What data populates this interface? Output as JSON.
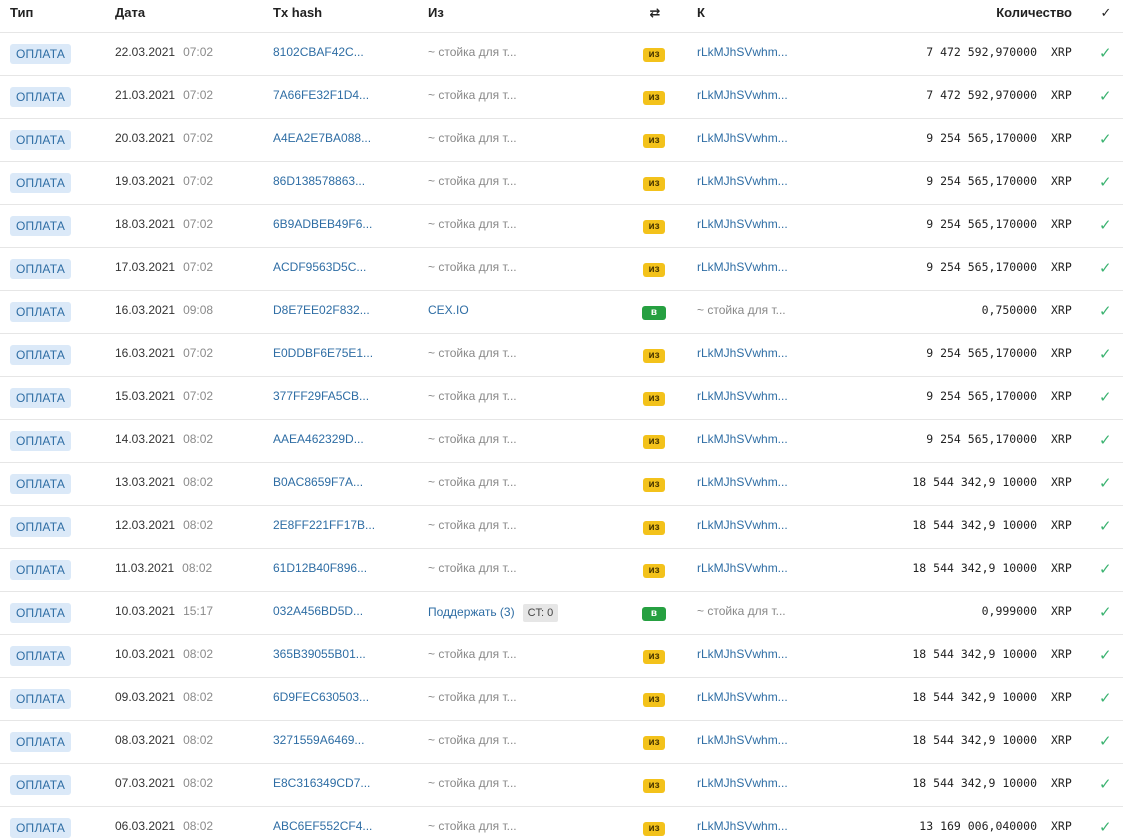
{
  "header": {
    "type": "Тип",
    "date": "Дата",
    "hash": "Tx hash",
    "from": "Из",
    "direction_icon": "⇄",
    "to": "К",
    "amount": "Количество",
    "status_icon": "✓"
  },
  "rows": [
    {
      "type": "ОПЛАТА",
      "date": "22.03.2021",
      "time": "07:02",
      "hash": "8102CBAF42C...",
      "from": "~ стойка для т...",
      "dir": "из",
      "to": "rLkMJhSVwhm...",
      "amount": "7 472 592,970000",
      "currency": "XRP"
    },
    {
      "type": "ОПЛАТА",
      "date": "21.03.2021",
      "time": "07:02",
      "hash": "7A66FE32F1D4...",
      "from": "~ стойка для т...",
      "dir": "из",
      "to": "rLkMJhSVwhm...",
      "amount": "7 472 592,970000",
      "currency": "XRP"
    },
    {
      "type": "ОПЛАТА",
      "date": "20.03.2021",
      "time": "07:02",
      "hash": "A4EA2E7BA088...",
      "from": "~ стойка для т...",
      "dir": "из",
      "to": "rLkMJhSVwhm...",
      "amount": "9 254 565,170000",
      "currency": "XRP"
    },
    {
      "type": "ОПЛАТА",
      "date": "19.03.2021",
      "time": "07:02",
      "hash": "86D138578863...",
      "from": "~ стойка для т...",
      "dir": "из",
      "to": "rLkMJhSVwhm...",
      "amount": "9 254 565,170000",
      "currency": "XRP"
    },
    {
      "type": "ОПЛАТА",
      "date": "18.03.2021",
      "time": "07:02",
      "hash": "6B9ADBEB49F6...",
      "from": "~ стойка для т...",
      "dir": "из",
      "to": "rLkMJhSVwhm...",
      "amount": "9 254 565,170000",
      "currency": "XRP"
    },
    {
      "type": "ОПЛАТА",
      "date": "17.03.2021",
      "time": "07:02",
      "hash": "ACDF9563D5C...",
      "from": "~ стойка для т...",
      "dir": "из",
      "to": "rLkMJhSVwhm...",
      "amount": "9 254 565,170000",
      "currency": "XRP"
    },
    {
      "type": "ОПЛАТА",
      "date": "16.03.2021",
      "time": "09:08",
      "hash": "D8E7EE02F832...",
      "from": "CEX.IO",
      "dir": "в",
      "to": "~ стойка для т...",
      "amount": "0,750000",
      "currency": "XRP"
    },
    {
      "type": "ОПЛАТА",
      "date": "16.03.2021",
      "time": "07:02",
      "hash": "E0DDBF6E75E1...",
      "from": "~ стойка для т...",
      "dir": "из",
      "to": "rLkMJhSVwhm...",
      "amount": "9 254 565,170000",
      "currency": "XRP"
    },
    {
      "type": "ОПЛАТА",
      "date": "15.03.2021",
      "time": "07:02",
      "hash": "377FF29FA5CB...",
      "from": "~ стойка для т...",
      "dir": "из",
      "to": "rLkMJhSVwhm...",
      "amount": "9 254 565,170000",
      "currency": "XRP"
    },
    {
      "type": "ОПЛАТА",
      "date": "14.03.2021",
      "time": "08:02",
      "hash": "AAEA462329D...",
      "from": "~ стойка для т...",
      "dir": "из",
      "to": "rLkMJhSVwhm...",
      "amount": "9 254 565,170000",
      "currency": "XRP"
    },
    {
      "type": "ОПЛАТА",
      "date": "13.03.2021",
      "time": "08:02",
      "hash": "B0AC8659F7A...",
      "from": "~ стойка для т...",
      "dir": "из",
      "to": "rLkMJhSVwhm...",
      "amount": "18 544 342,9 10000",
      "currency": "XRP"
    },
    {
      "type": "ОПЛАТА",
      "date": "12.03.2021",
      "time": "08:02",
      "hash": "2E8FF221FF17B...",
      "from": "~ стойка для т...",
      "dir": "из",
      "to": "rLkMJhSVwhm...",
      "amount": "18 544 342,9 10000",
      "currency": "XRP"
    },
    {
      "type": "ОПЛАТА",
      "date": "11.03.2021",
      "time": "08:02",
      "hash": "61D12B40F896...",
      "from": "~ стойка для т...",
      "dir": "из",
      "to": "rLkMJhSVwhm...",
      "amount": "18 544 342,9 10000",
      "currency": "XRP"
    },
    {
      "type": "ОПЛАТА",
      "date": "10.03.2021",
      "time": "15:17",
      "hash": "032A456BD5D...",
      "from": "Поддержать (3)",
      "from_tag": "CT: 0",
      "dir": "в",
      "to": "~ стойка для т...",
      "amount": "0,999000",
      "currency": "XRP"
    },
    {
      "type": "ОПЛАТА",
      "date": "10.03.2021",
      "time": "08:02",
      "hash": "365B39055B01...",
      "from": "~ стойка для т...",
      "dir": "из",
      "to": "rLkMJhSVwhm...",
      "amount": "18 544 342,9 10000",
      "currency": "XRP"
    },
    {
      "type": "ОПЛАТА",
      "date": "09.03.2021",
      "time": "08:02",
      "hash": "6D9FEC630503...",
      "from": "~ стойка для т...",
      "dir": "из",
      "to": "rLkMJhSVwhm...",
      "amount": "18 544 342,9 10000",
      "currency": "XRP"
    },
    {
      "type": "ОПЛАТА",
      "date": "08.03.2021",
      "time": "08:02",
      "hash": "3271559A6469...",
      "from": "~ стойка для т...",
      "dir": "из",
      "to": "rLkMJhSVwhm...",
      "amount": "18 544 342,9 10000",
      "currency": "XRP"
    },
    {
      "type": "ОПЛАТА",
      "date": "07.03.2021",
      "time": "08:02",
      "hash": "E8C316349CD7...",
      "from": "~ стойка для т...",
      "dir": "из",
      "to": "rLkMJhSVwhm...",
      "amount": "18 544 342,9 10000",
      "currency": "XRP"
    },
    {
      "type": "ОПЛАТА",
      "date": "06.03.2021",
      "time": "08:02",
      "hash": "ABC6EF552CF4...",
      "from": "~ стойка для т...",
      "dir": "из",
      "to": "rLkMJhSVwhm...",
      "amount": "13 169 006,040000",
      "currency": "XRP"
    }
  ]
}
